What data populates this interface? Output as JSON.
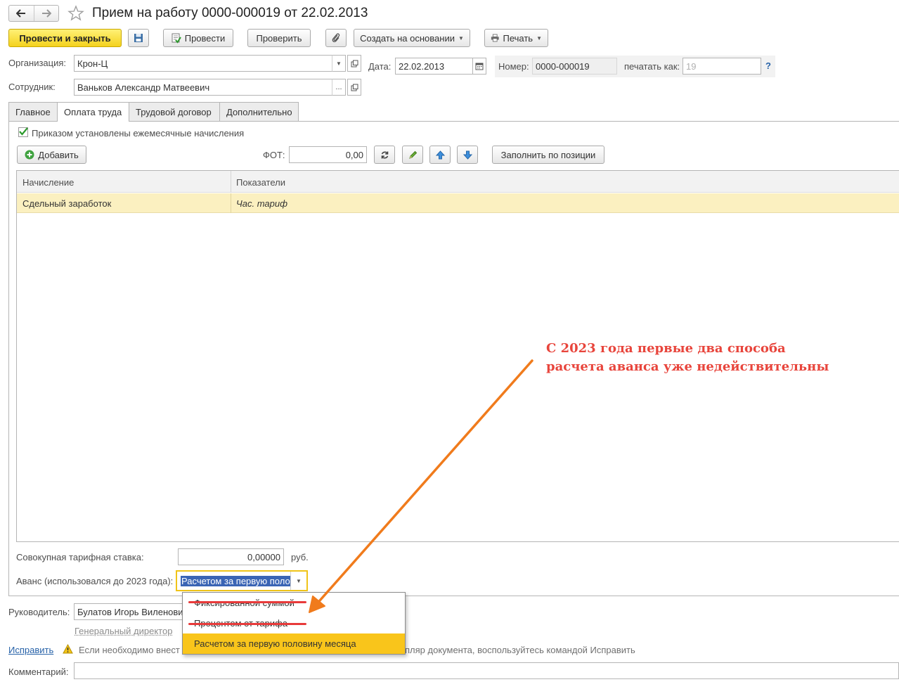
{
  "window": {
    "title": "Прием на работу 0000-000019 от 22.02.2013"
  },
  "toolbar": {
    "post_close_label": "Провести и закрыть",
    "post_label": "Провести",
    "check_label": "Проверить",
    "create_based_label": "Создать на основании",
    "print_label": "Печать"
  },
  "header": {
    "org_label": "Организация:",
    "org_value": "Крон-Ц",
    "date_label": "Дата:",
    "date_value": "22.02.2013",
    "number_label": "Номер:",
    "number_value": "0000-000019",
    "print_as_label": "печатать как:",
    "print_as_placeholder": "19",
    "help_label": "?",
    "employee_label": "Сотрудник:",
    "employee_value": "Ваньков Александр Матвеевич",
    "ellipsis": "..."
  },
  "tabs": [
    {
      "label": "Главное"
    },
    {
      "label": "Оплата труда"
    },
    {
      "label": "Трудовой договор"
    },
    {
      "label": "Дополнительно"
    }
  ],
  "pay": {
    "monthly_checkbox_label": "Приказом установлены ежемесячные начисления",
    "monthly_checked": true,
    "add_label": "Добавить",
    "fot_label": "ФОТ:",
    "fot_value": "0,00",
    "fill_by_position_label": "Заполнить по позиции",
    "columns": [
      "Начисление",
      "Показатели"
    ],
    "rows": [
      {
        "accrual": "Сдельный заработок",
        "indicators": "Час. тариф"
      }
    ],
    "total_rate_label": "Совокупная тарифная ставка:",
    "total_rate_value": "0,00000",
    "currency": "руб.",
    "advance_label": "Аванс (использовался до 2023 года):",
    "advance_value": "Расчетом за первую поло",
    "advance_options": [
      {
        "label": "Фиксированной суммой",
        "struck": true
      },
      {
        "label": "Процентом от тарифа",
        "struck": true
      },
      {
        "label": "Расчетом за первую половину месяца",
        "selected": true
      }
    ]
  },
  "footer": {
    "manager_label": "Руководитель:",
    "manager_value": "Булатов Игорь Виленови",
    "manager_position": "Генеральный директор",
    "fix_link": "Исправить",
    "warning_left": "Если необходимо внест",
    "warning_right": "пляр документа, воспользуйтесь командой Исправить",
    "comment_label": "Комментарий:"
  },
  "annotation": {
    "line1": "С 2023 года первые два способа",
    "line2": "расчета аванса уже недействительны",
    "color": "#e8453c",
    "arrow_color": "#f07b1c"
  },
  "colors": {
    "primary_button": "#f4d21e",
    "selected_row": "#fbf0c0",
    "selected_option": "#f9c51b",
    "link": "#2762a8"
  }
}
